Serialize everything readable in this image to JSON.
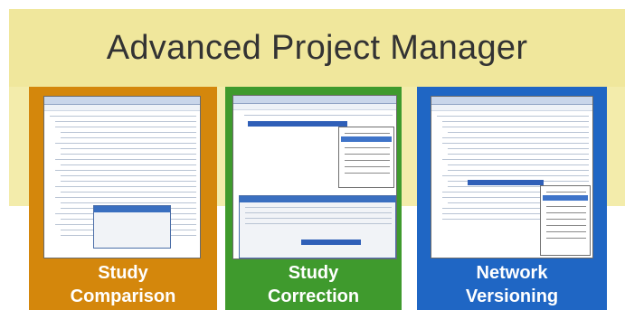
{
  "header": {
    "title": "Advanced Project Manager"
  },
  "panels": [
    {
      "id": "study-comparison",
      "label_line1": "Study",
      "label_line2": "Comparison",
      "color": "#d4870c"
    },
    {
      "id": "study-correction",
      "label_line1": "Study",
      "label_line2": "Correction",
      "color": "#3f9a2d"
    },
    {
      "id": "network-versioning",
      "label_line1": "Network",
      "label_line2": "Versioning",
      "color": "#1f66c4"
    }
  ],
  "colors": {
    "banner": "#f0e79c",
    "title_text": "#333333"
  }
}
